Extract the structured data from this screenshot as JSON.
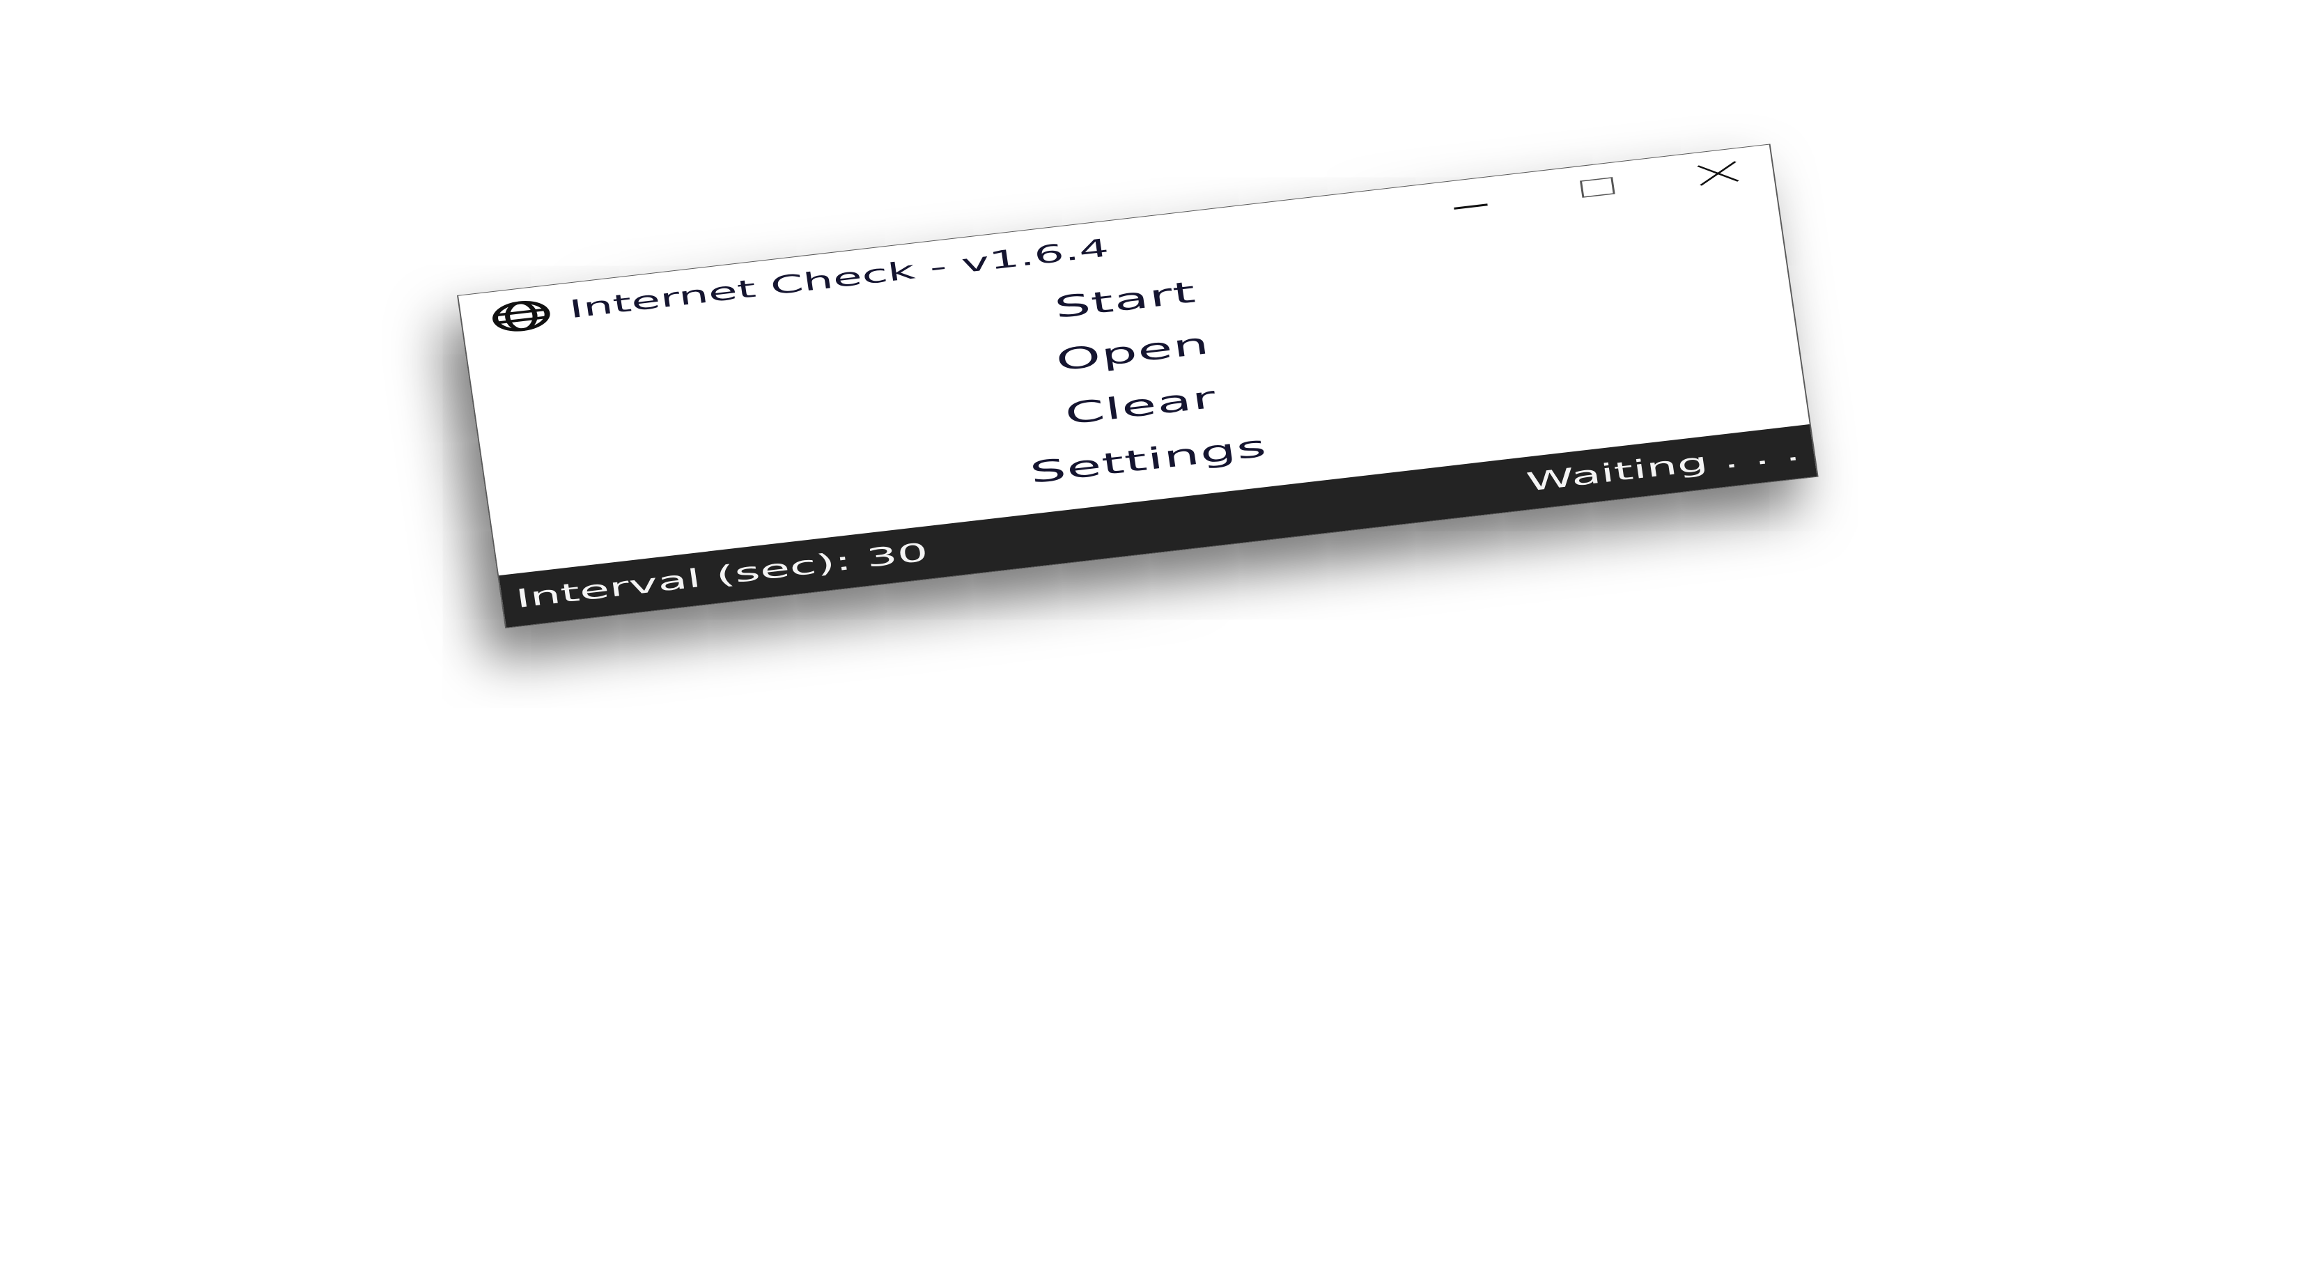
{
  "window": {
    "title": "Internet Check - v1.6.4",
    "icon": "globe-icon",
    "controls": {
      "minimize": "minimize-icon",
      "maximize": "maximize-icon",
      "close": "close-icon"
    }
  },
  "menu": {
    "items": [
      {
        "label": "Start"
      },
      {
        "label": "Open"
      },
      {
        "label": "Clear"
      },
      {
        "label": "Settings"
      }
    ]
  },
  "status": {
    "interval": "Interval (sec): 30",
    "state": "Waiting . . ."
  },
  "colors": {
    "text": "#151530",
    "statusbar_bg": "#232323",
    "statusbar_text": "#f4f4f4",
    "window_bg": "#ffffff"
  }
}
